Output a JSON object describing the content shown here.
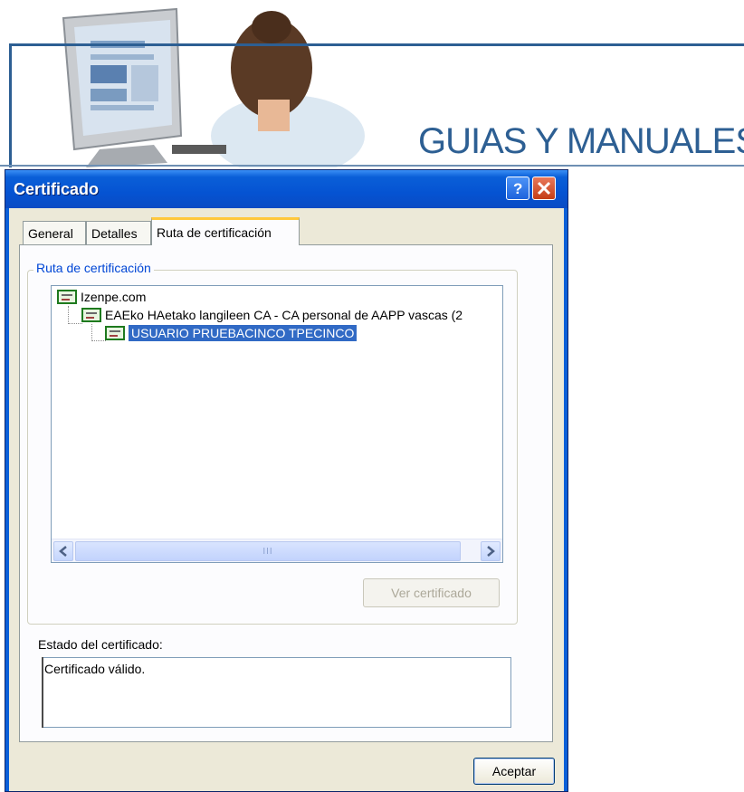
{
  "banner": {
    "title": "GUIAS Y MANUALES"
  },
  "dialog": {
    "title": "Certificado",
    "help_icon": "help-icon",
    "close_icon": "close-icon",
    "tabs": [
      {
        "label": "General"
      },
      {
        "label": "Detalles"
      },
      {
        "label": "Ruta de certificación"
      }
    ],
    "active_tab": "Ruta de certificación",
    "group_label": "Ruta de certificación",
    "tree": [
      {
        "label": "Izenpe.com",
        "level": 0
      },
      {
        "label": "EAEko HAetako langileen CA - CA personal de AAPP vascas (2",
        "level": 1
      },
      {
        "label": "USUARIO PRUEBACINCO TPECINCO",
        "level": 2,
        "selected": true
      }
    ],
    "scrollbar_thumb_text": "III",
    "view_button": "Ver certificado",
    "status_label": "Estado del certificado:",
    "status_text": "Certificado válido.",
    "ok_button": "Aceptar"
  },
  "colors": {
    "title_bar": "#0a5fd8",
    "banner_blue": "#2d5f93",
    "selection": "#316ac5",
    "dialog_bg": "#ece9d8"
  }
}
